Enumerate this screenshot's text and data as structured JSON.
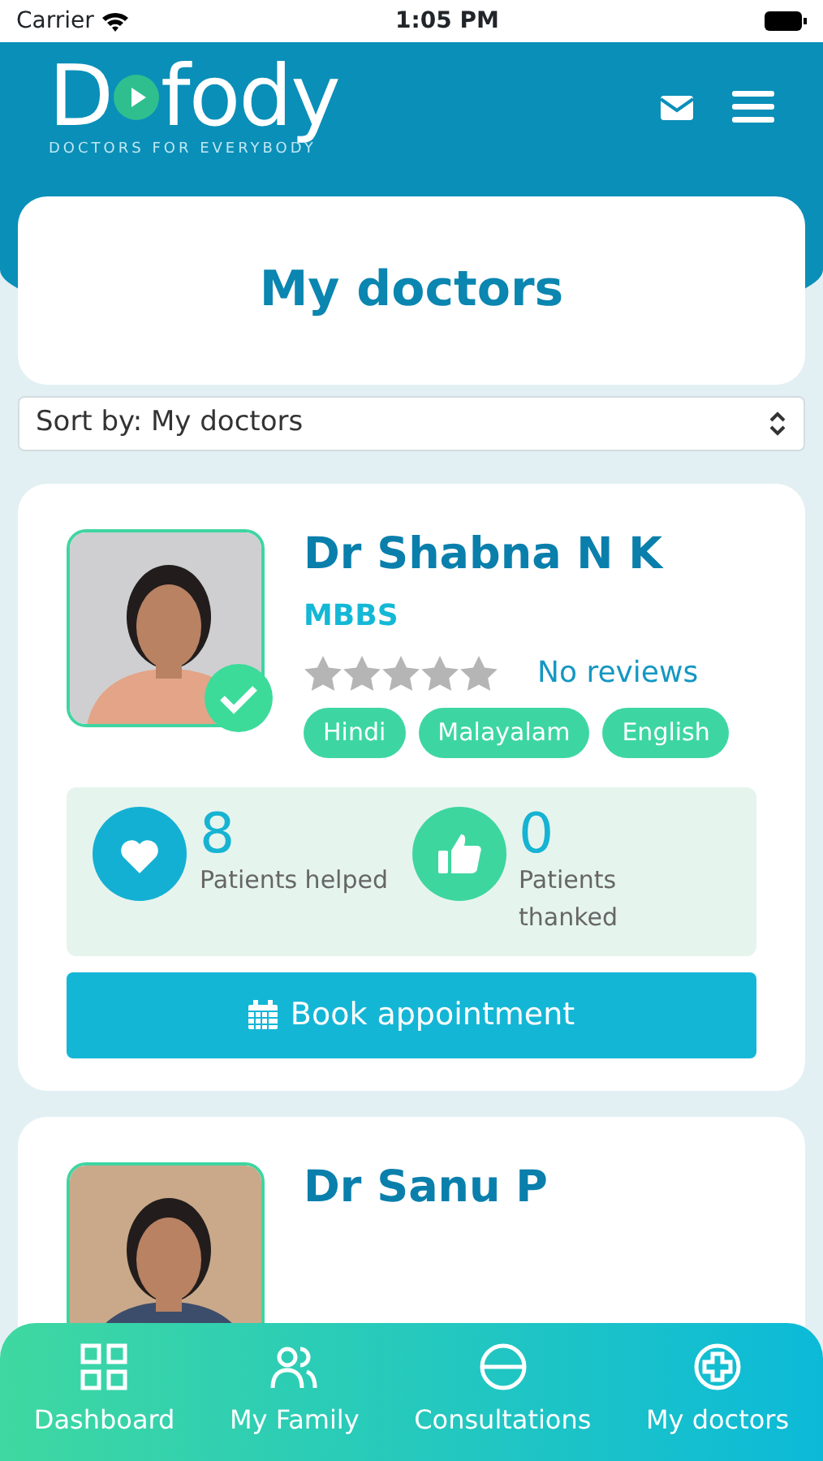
{
  "status_bar": {
    "carrier": "Carrier",
    "time": "1:05 PM"
  },
  "header": {
    "logo_left": "D",
    "logo_right": "fody",
    "tagline": "DOCTORS FOR EVERYBODY"
  },
  "page_title": "My doctors",
  "sort": {
    "value": "Sort by: My doctors"
  },
  "doctors": [
    {
      "name": "Dr Shabna N K",
      "degree": "MBBS",
      "stars": 0,
      "reviews": "No reviews",
      "verified": true,
      "languages": [
        "Hindi",
        "Malayalam",
        "English"
      ],
      "stats": [
        {
          "kind": "heart",
          "value": "8",
          "label": "Patients helped"
        },
        {
          "kind": "thumb",
          "value": "0",
          "label": "Patients thanked"
        }
      ],
      "button": "Book appointment"
    },
    {
      "name": "Dr Sanu P",
      "verified": false
    }
  ],
  "bottom_nav": [
    {
      "kind": "grid",
      "label": "Dashboard"
    },
    {
      "kind": "people",
      "label": "My Family"
    },
    {
      "kind": "pill",
      "label": "Consultations"
    },
    {
      "kind": "plus",
      "label": "My doctors"
    }
  ]
}
